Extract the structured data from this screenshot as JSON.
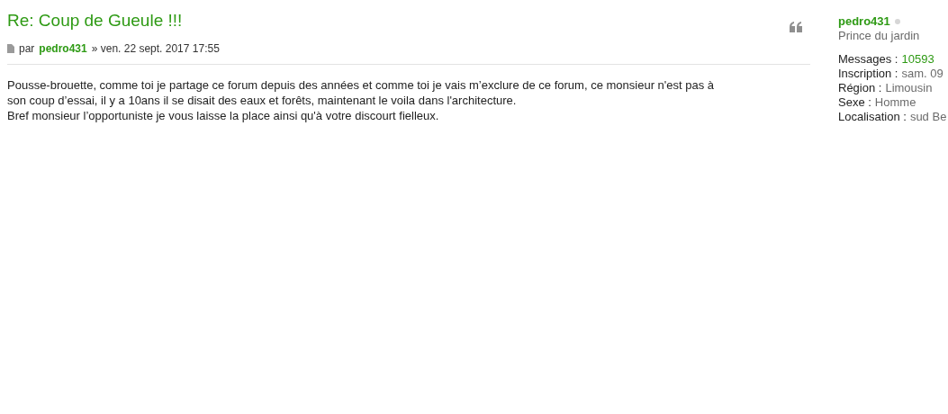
{
  "post": {
    "title": "Re: Coup de Gueule !!!",
    "meta": {
      "by": "par",
      "author": "pedro431",
      "date": "» ven. 22 sept. 2017 17:55"
    },
    "body": [
      "Pousse-brouette, comme toi je partage ce forum depuis des années et comme toi je vais m’exclure de ce forum, ce monsieur n'est pas à",
      "son coup d’essai, il y a 10ans il se disait des eaux et forêts, maintenant le voila dans l'architecture.",
      "Bref monsieur l’opportuniste je vous laisse la place ainsi qu'à votre discourt fielleux."
    ]
  },
  "profile": {
    "username": "pedro431",
    "online": false,
    "rank": "Prince du jardin",
    "fields": [
      {
        "label": "Messages :",
        "value": "10593",
        "kind": "link"
      },
      {
        "label": "Inscription :",
        "value": "sam. 09",
        "kind": "text"
      },
      {
        "label": "Région :",
        "value": "Limousin",
        "kind": "text"
      },
      {
        "label": "Sexe :",
        "value": "Homme",
        "kind": "text"
      },
      {
        "label": "Localisation :",
        "value": "sud Be",
        "kind": "text"
      }
    ]
  }
}
